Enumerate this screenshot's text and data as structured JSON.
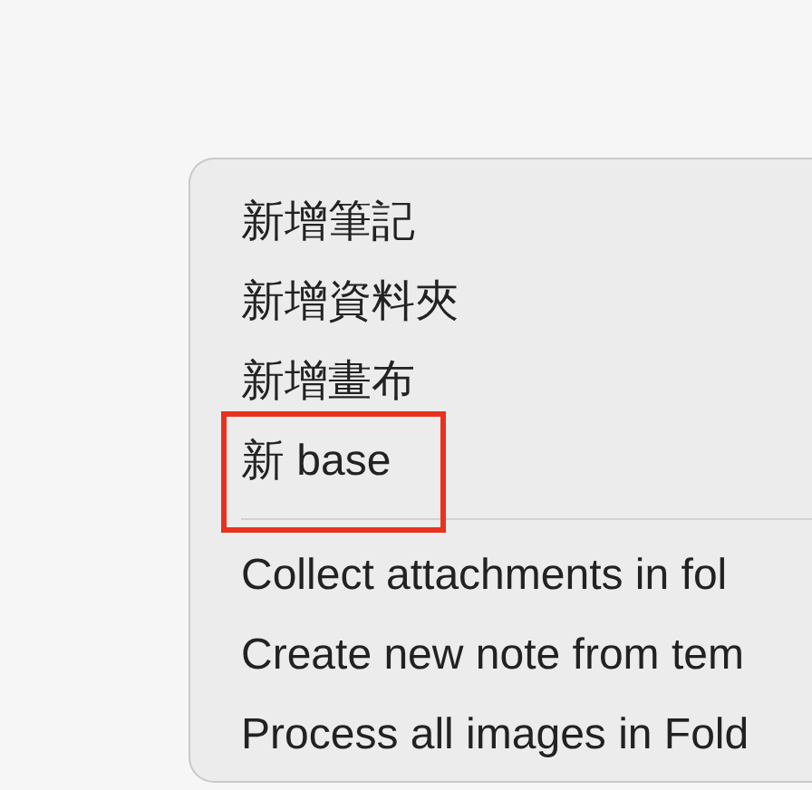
{
  "menu": {
    "groups": [
      {
        "items": [
          {
            "label": "新增筆記",
            "highlighted": false
          },
          {
            "label": "新增資料夾",
            "highlighted": false
          },
          {
            "label": "新增畫布",
            "highlighted": false
          },
          {
            "label": "新 base",
            "highlighted": true
          }
        ]
      },
      {
        "items": [
          {
            "label": "Collect attachments in fol",
            "highlighted": false
          },
          {
            "label": "Create new note from tem",
            "highlighted": false
          },
          {
            "label": "Process all images in Fold",
            "highlighted": false
          }
        ]
      }
    ]
  }
}
